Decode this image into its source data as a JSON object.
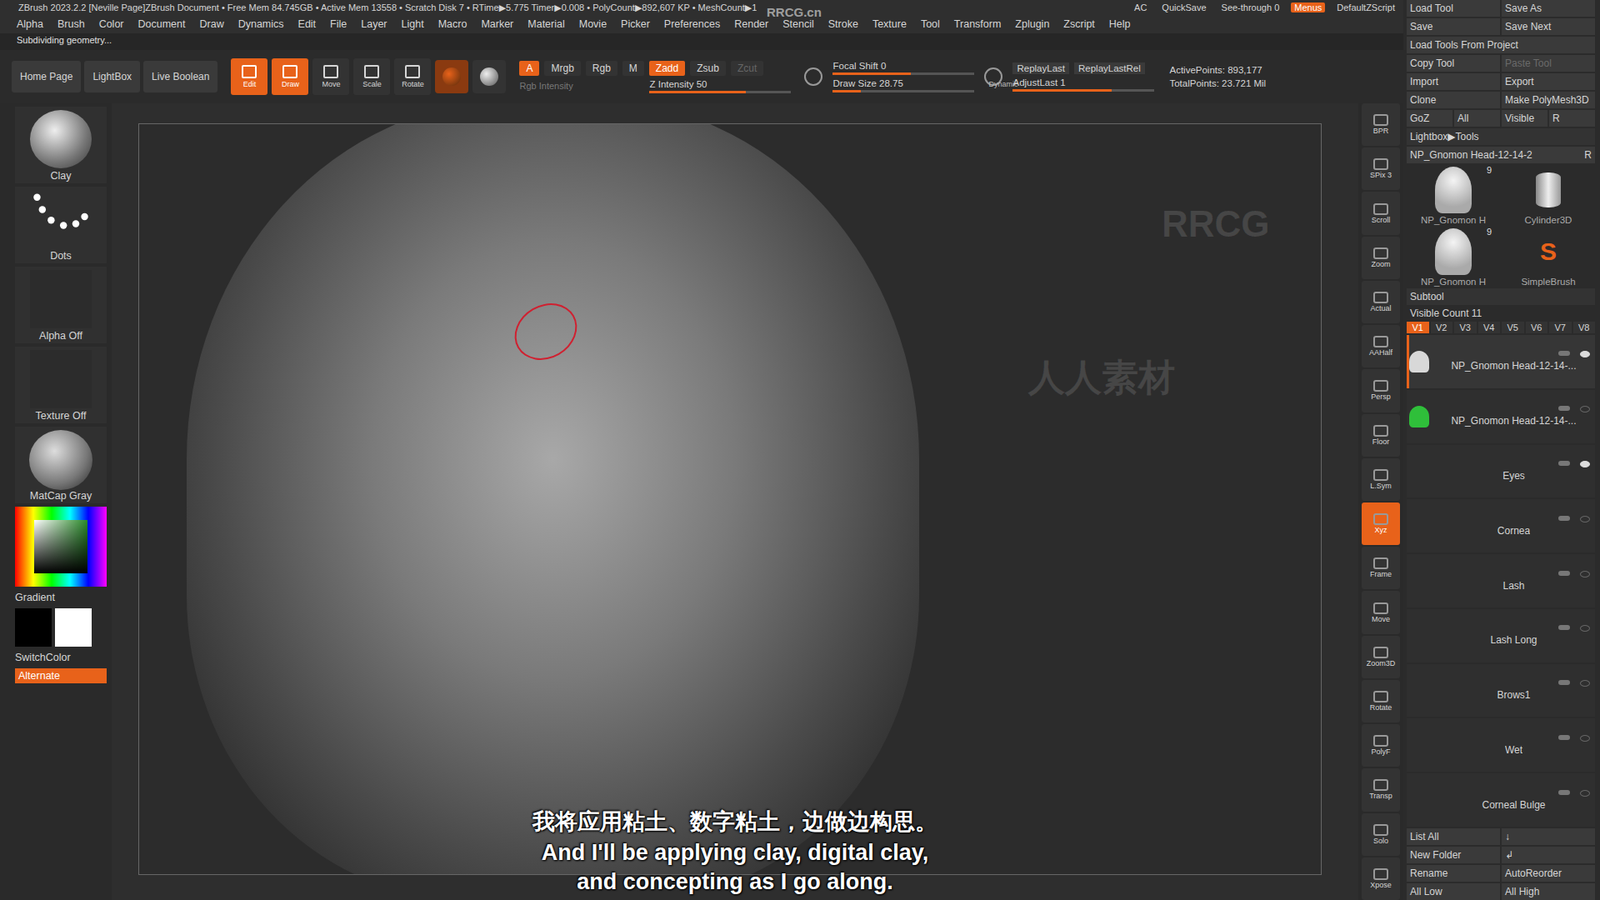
{
  "title_bar": {
    "text": "ZBrush 2023.2.2 [Neville Page]ZBrush Document   • Free Mem 84.745GB • Active Mem 13558 • Scratch Disk 7 • RTime▶5.775 Timer▶0.008 • PolyCount▶892,607 KP • MeshCount▶1",
    "buttons": [
      {
        "label": "AC",
        "selected": false
      },
      {
        "label": "QuickSave",
        "selected": false
      },
      {
        "label": "See-through  0",
        "selected": false
      },
      {
        "label": "Menus",
        "selected": true
      },
      {
        "label": "DefaultZScript",
        "selected": false
      }
    ]
  },
  "menu": [
    "Alpha",
    "Brush",
    "Color",
    "Document",
    "Draw",
    "Dynamics",
    "Edit",
    "File",
    "Layer",
    "Light",
    "Macro",
    "Marker",
    "Material",
    "Movie",
    "Picker",
    "Preferences",
    "Render",
    "Stencil",
    "Stroke",
    "Texture",
    "Tool",
    "Transform",
    "Zplugin",
    "Zscript",
    "Help"
  ],
  "status": "Subdividing geometry...",
  "shelf": {
    "nav": [
      "Home Page",
      "LightBox",
      "Live Boolean"
    ],
    "tools": [
      {
        "label": "Edit",
        "selected": true
      },
      {
        "label": "Draw",
        "selected": true
      },
      {
        "label": "Move",
        "selected": false
      },
      {
        "label": "Scale",
        "selected": false
      },
      {
        "label": "Rotate",
        "selected": false
      }
    ],
    "modes": [
      {
        "label": "A",
        "selected": true
      },
      {
        "label": "Mrgb",
        "selected": false
      },
      {
        "label": "Rgb",
        "selected": false
      },
      {
        "label": "M",
        "selected": false
      }
    ],
    "rgb_intensity": "Rgb Intensity",
    "depth": [
      {
        "label": "Zadd",
        "selected": true,
        "disabled": false
      },
      {
        "label": "Zsub",
        "selected": false,
        "disabled": false
      },
      {
        "label": "Zcut",
        "selected": false,
        "disabled": true
      }
    ],
    "z_intensity": {
      "label": "Z Intensity 50",
      "level": 0.68
    },
    "focal_shift": {
      "label": "Focal Shift 0",
      "level": 0.55
    },
    "draw_size": {
      "label": "Draw Size 28.75",
      "level": 0.2
    },
    "dynamic": "Dynamic",
    "replay": [
      "ReplayLast",
      "ReplayLastRel"
    ],
    "adjust_last": {
      "label": "AdjustLast 1",
      "level": 0.7
    },
    "points": [
      "ActivePoints: 893,177",
      "TotalPoints: 23.721 Mil"
    ]
  },
  "left_shelf": {
    "brush": "Clay",
    "stroke": "Dots",
    "alpha": "Alpha Off",
    "texture": "Texture Off",
    "material": "MatCap Gray",
    "gradient": "Gradient",
    "switch_color": "SwitchColor",
    "main_color": "#000000",
    "secondary_color": "#ffffff",
    "alternate": {
      "label": "Alternate",
      "on": true
    }
  },
  "view_strip": [
    {
      "label": "BPR",
      "on": false
    },
    {
      "label": "SPix 3",
      "on": false
    },
    {
      "label": "Scroll",
      "on": false
    },
    {
      "label": "Zoom",
      "on": false
    },
    {
      "label": "Actual",
      "on": false
    },
    {
      "label": "AAHalf",
      "on": false
    },
    {
      "label": "Persp",
      "on": false
    },
    {
      "label": "Floor",
      "on": false
    },
    {
      "label": "L.Sym",
      "on": false
    },
    {
      "label": "Xyz",
      "on": true
    },
    {
      "label": "Frame",
      "on": false
    },
    {
      "label": "Move",
      "on": false
    },
    {
      "label": "Zoom3D",
      "on": false
    },
    {
      "label": "Rotate",
      "on": false
    },
    {
      "label": "PolyF",
      "on": false
    },
    {
      "label": "Transp",
      "on": false
    },
    {
      "label": "Solo",
      "on": false
    },
    {
      "label": "Xpose",
      "on": false
    }
  ],
  "right_panel": {
    "buttons": [
      [
        {
          "label": "Load Tool",
          "disabled": false
        },
        {
          "label": "Save As",
          "disabled": false
        }
      ],
      [
        {
          "label": "Save",
          "disabled": false
        },
        {
          "label": "Save Next",
          "disabled": false
        }
      ],
      [
        {
          "label": "Load Tools From Project",
          "disabled": false
        }
      ],
      [
        {
          "label": "Copy Tool",
          "disabled": false
        },
        {
          "label": "Paste Tool",
          "disabled": true
        }
      ],
      [
        {
          "label": "Import",
          "disabled": false
        },
        {
          "label": "Export",
          "disabled": false
        }
      ],
      [
        {
          "label": "Clone",
          "disabled": false
        },
        {
          "label": "Make PolyMesh3D",
          "disabled": false
        }
      ],
      [
        {
          "label": "GoZ",
          "disabled": false
        },
        {
          "label": "All",
          "disabled": false
        },
        {
          "label": "Visible",
          "disabled": false
        },
        {
          "label": "R",
          "disabled": false
        }
      ]
    ],
    "lightbox": "Lightbox▶Tools",
    "current_tool": {
      "name": "NP_Gnomon Head-12-14-2",
      "r": "R"
    },
    "thumbnails": [
      {
        "name": "NP_Gnomon H",
        "count": "9",
        "kind": "bust"
      },
      {
        "name": "Cylinder3D",
        "count": "",
        "kind": "cylinder"
      },
      {
        "name": "NP_Gnomon H",
        "count": "9",
        "kind": "bust"
      },
      {
        "name": "SimpleBrush",
        "count": "",
        "kind": "brush"
      }
    ],
    "subtool_title": "Subtool",
    "visible_count": "Visible Count 11",
    "versions": [
      {
        "label": "V1",
        "selected": true
      },
      {
        "label": "V2",
        "selected": false
      },
      {
        "label": "V3",
        "selected": false
      },
      {
        "label": "V4",
        "selected": false
      },
      {
        "label": "V5",
        "selected": false
      },
      {
        "label": "V6",
        "selected": false
      },
      {
        "label": "V7",
        "selected": false
      },
      {
        "label": "V8",
        "selected": false
      }
    ],
    "subtools": [
      {
        "name": "NP_Gnomon Head-12-14-...",
        "selected": true,
        "visible": true,
        "color": "#d8d8d8"
      },
      {
        "name": "NP_Gnomon Head-12-14-...",
        "selected": false,
        "visible": false,
        "color": "#2fbf3a"
      },
      {
        "name": "Eyes",
        "selected": false,
        "visible": true,
        "color": ""
      },
      {
        "name": "Cornea",
        "selected": false,
        "visible": false,
        "color": ""
      },
      {
        "name": "Lash",
        "selected": false,
        "visible": false,
        "color": ""
      },
      {
        "name": "Lash Long",
        "selected": false,
        "visible": false,
        "color": ""
      },
      {
        "name": "Brows1",
        "selected": false,
        "visible": false,
        "color": ""
      },
      {
        "name": "Wet",
        "selected": false,
        "visible": false,
        "color": ""
      },
      {
        "name": "Corneal Bulge",
        "selected": false,
        "visible": false,
        "color": ""
      }
    ],
    "bottom_buttons": [
      [
        "List All",
        "↓"
      ],
      [
        "New Folder",
        "↲"
      ],
      [
        "Rename",
        "AutoReorder"
      ],
      [
        "All Low",
        "All High"
      ]
    ]
  },
  "subtitles": [
    "我将应用粘土、数字粘土，边做边构思。",
    "And I'll be applying clay, digital clay,",
    "and concepting as I go along."
  ],
  "watermarks": [
    "RRCG.cn",
    "RRCG",
    "人人素材"
  ]
}
